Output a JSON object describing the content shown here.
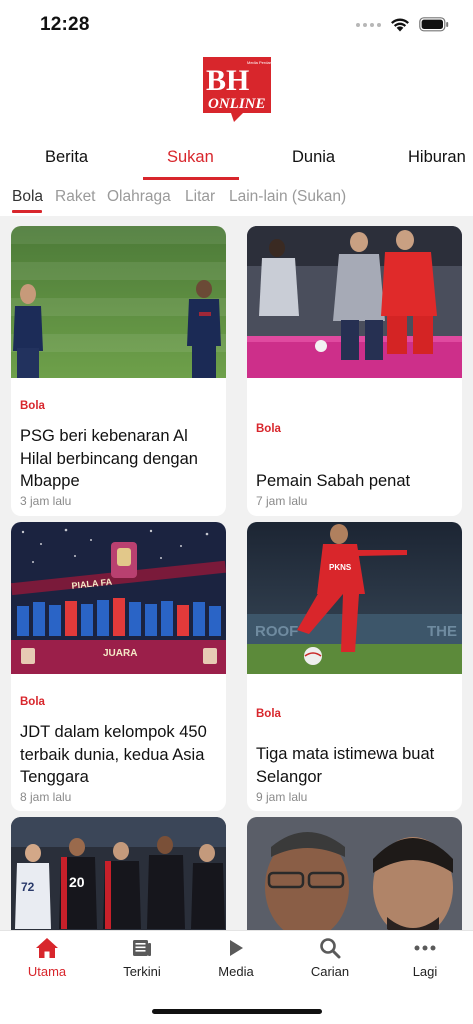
{
  "status_bar": {
    "time": "12:28"
  },
  "logo": {
    "main": "BH",
    "sub": "ONLINE",
    "tagline": "Media Perdana"
  },
  "primary_tabs": [
    {
      "label": "Berita",
      "active": false
    },
    {
      "label": "Sukan",
      "active": true
    },
    {
      "label": "Dunia",
      "active": false
    },
    {
      "label": "Hiburan",
      "active": false
    }
  ],
  "secondary_tabs": [
    {
      "label": "Bola",
      "active": true
    },
    {
      "label": "Raket",
      "active": false
    },
    {
      "label": "Olahraga",
      "active": false
    },
    {
      "label": "Litar",
      "active": false
    },
    {
      "label": "Lain-lain (Sukan)",
      "active": false
    }
  ],
  "articles": [
    {
      "category": "Bola",
      "title": "PSG beri kebenaran Al Hilal berbincang dengan Mbappe",
      "time": "3 jam lalu",
      "image": "football-pitch-players-photo"
    },
    {
      "category": "Bola",
      "title": "Pemain Sabah penat",
      "time": "7 jam lalu",
      "image": "football-match-action-photo"
    },
    {
      "category": "Bola",
      "title": "JDT dalam kelompok 450 terbaik dunia, kedua Asia Tenggara",
      "time": "8 jam lalu",
      "image": "trophy-celebration-photo"
    },
    {
      "category": "Bola",
      "title": "Tiga mata istimewa buat Selangor",
      "time": "9 jam lalu",
      "image": "player-kicking-ball-photo"
    },
    {
      "category": "",
      "title": "",
      "time": "",
      "image": "team-players-photo"
    },
    {
      "category": "",
      "title": "",
      "time": "",
      "image": "officials-portrait-photo"
    }
  ],
  "image_text": {
    "banner_1": "JUARA",
    "banner_2": "PIALA FA",
    "shirt_sponsor": "PKNS",
    "jersey_number": "20",
    "stadium_sign": "ROOF",
    "stadium_sign_2": "THE"
  },
  "bottom_nav": [
    {
      "label": "Utama",
      "icon": "home-icon",
      "active": true
    },
    {
      "label": "Terkini",
      "icon": "news-icon",
      "active": false
    },
    {
      "label": "Media",
      "icon": "play-icon",
      "active": false
    },
    {
      "label": "Carian",
      "icon": "search-icon",
      "active": false
    },
    {
      "label": "Lagi",
      "icon": "more-icon",
      "active": false
    }
  ],
  "colors": {
    "accent": "#d8262c",
    "muted": "#9a9a9a",
    "background": "#f1f1f1"
  }
}
